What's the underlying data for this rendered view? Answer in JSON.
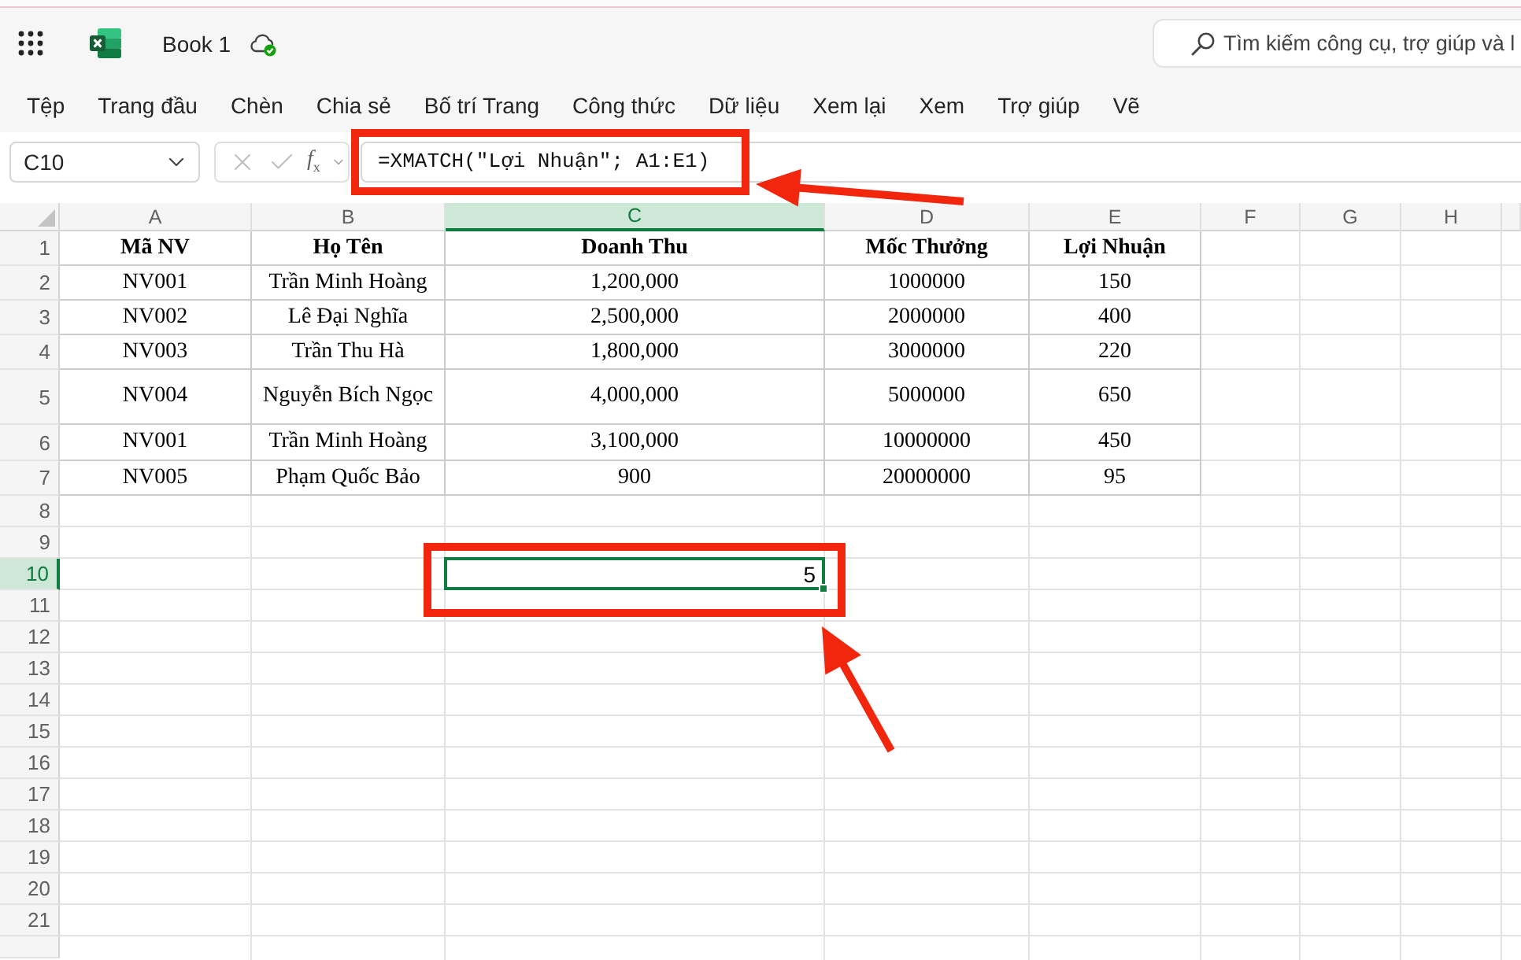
{
  "app_bar": {
    "document_title": "Book 1",
    "search": {
      "placeholder": "Tìm kiếm công cụ, trợ giúp và l"
    }
  },
  "menu": [
    "Tệp",
    "Trang đầu",
    "Chèn",
    "Chia sẻ",
    "Bố trí Trang",
    "Công thức",
    "Dữ liệu",
    "Xem lại",
    "Xem",
    "Trợ giúp",
    "Vẽ"
  ],
  "formula_bar": {
    "name_box": "C10",
    "function_button": "*f*$_{x}$",
    "formula": "=XMATCH(\"Lợi Nhuận\"; A1:E1)"
  },
  "columns": [
    {
      "label": "A",
      "selected": false
    },
    {
      "label": "B",
      "selected": false
    },
    {
      "label": "C",
      "selected": true
    },
    {
      "label": "D",
      "selected": false
    },
    {
      "label": "E",
      "selected": false
    },
    {
      "label": "F",
      "selected": false
    },
    {
      "label": "G",
      "selected": false
    },
    {
      "label": "H",
      "selected": false
    }
  ],
  "rows": [
    {
      "number": "1",
      "kind": "header",
      "selected": false,
      "cells": [
        "Mã NV",
        "Họ Tên",
        "Doanh Thu",
        "Mốc Thưởng",
        "Lợi Nhuận"
      ]
    },
    {
      "number": "2",
      "kind": "data",
      "selected": false,
      "cells": [
        "NV001",
        "Trần Minh Hoàng",
        "1,200,000",
        "1000000",
        "150"
      ]
    },
    {
      "number": "3",
      "kind": "data",
      "selected": false,
      "cells": [
        "NV002",
        "Lê Đại Nghĩa",
        "2,500,000",
        "2000000",
        "400"
      ]
    },
    {
      "number": "4",
      "kind": "data",
      "selected": false,
      "cells": [
        "NV003",
        "Trần Thu Hà",
        "1,800,000",
        "3000000",
        "220"
      ]
    },
    {
      "number": "5",
      "kind": "data",
      "selected": false,
      "cells": [
        "NV004",
        "Nguyễn Bích Ngọc",
        "4,000,000",
        "5000000",
        "650"
      ]
    },
    {
      "number": "6",
      "kind": "data",
      "selected": false,
      "cells": [
        "NV001",
        "Trần Minh Hoàng",
        "3,100,000",
        "10000000",
        "450"
      ]
    },
    {
      "number": "7",
      "kind": "data",
      "selected": false,
      "cells": [
        "NV005",
        "Phạm Quốc Bảo",
        "900",
        "20000000",
        "95"
      ]
    },
    {
      "number": "8",
      "kind": "empty",
      "selected": false
    },
    {
      "number": "9",
      "kind": "empty",
      "selected": false
    },
    {
      "number": "10",
      "kind": "empty",
      "selected": true
    },
    {
      "number": "11",
      "kind": "empty",
      "selected": false
    },
    {
      "number": "12",
      "kind": "empty",
      "selected": false
    },
    {
      "number": "13",
      "kind": "empty",
      "selected": false
    },
    {
      "number": "14",
      "kind": "empty",
      "selected": false
    },
    {
      "number": "15",
      "kind": "empty",
      "selected": false
    },
    {
      "number": "16",
      "kind": "empty",
      "selected": false
    },
    {
      "number": "17",
      "kind": "empty",
      "selected": false
    },
    {
      "number": "18",
      "kind": "empty",
      "selected": false
    },
    {
      "number": "19",
      "kind": "empty",
      "selected": false
    },
    {
      "number": "20",
      "kind": "empty",
      "selected": false
    },
    {
      "number": "21",
      "kind": "empty",
      "selected": false
    }
  ],
  "active_cell": {
    "value": "5"
  }
}
